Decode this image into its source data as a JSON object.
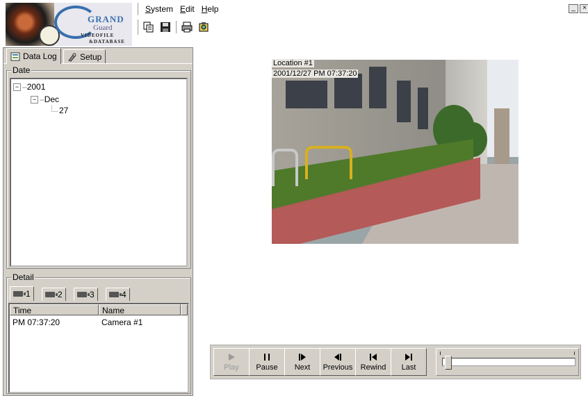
{
  "logo": {
    "line1": "GRAND",
    "line2": "Guard",
    "line3": "VIDEOFILE",
    "line4": "&DATABASE"
  },
  "menu": {
    "items": [
      {
        "label": "System"
      },
      {
        "label": "Edit"
      },
      {
        "label": "Help"
      }
    ]
  },
  "toolbar": {
    "icons": [
      "copy-icon",
      "save-icon",
      "print-icon",
      "settings-icon"
    ]
  },
  "window_controls": {
    "minimize": "_",
    "close": "×"
  },
  "left_tabs": [
    {
      "label": "Data Log",
      "icon": "log-icon",
      "selected": true
    },
    {
      "label": "Setup",
      "icon": "setup-icon",
      "selected": false
    }
  ],
  "date_panel": {
    "title": "Date",
    "tree": {
      "year": "2001",
      "month": "Dec",
      "day": "27"
    }
  },
  "detail_panel": {
    "title": "Detail",
    "camera_tabs": [
      {
        "label": "1"
      },
      {
        "label": "2"
      },
      {
        "label": "3"
      },
      {
        "label": "4"
      }
    ],
    "columns": [
      "Time",
      "Name"
    ],
    "rows": [
      {
        "time": "PM 07:37:20",
        "name": "Camera #1"
      }
    ]
  },
  "video": {
    "location": "Location #1",
    "timestamp": "2001/12/27  PM 07:37:20"
  },
  "playback": {
    "buttons": [
      {
        "label": "Play",
        "icon": "play-icon",
        "enabled": false
      },
      {
        "label": "Pause",
        "icon": "pause-icon",
        "enabled": true
      },
      {
        "label": "Next",
        "icon": "next-frame-icon",
        "enabled": true
      },
      {
        "label": "Previous",
        "icon": "previous-frame-icon",
        "enabled": true
      },
      {
        "label": "Rewind",
        "icon": "rewind-icon",
        "enabled": true
      },
      {
        "label": "Last",
        "icon": "last-icon",
        "enabled": true
      }
    ],
    "position_fraction": 0.02
  }
}
